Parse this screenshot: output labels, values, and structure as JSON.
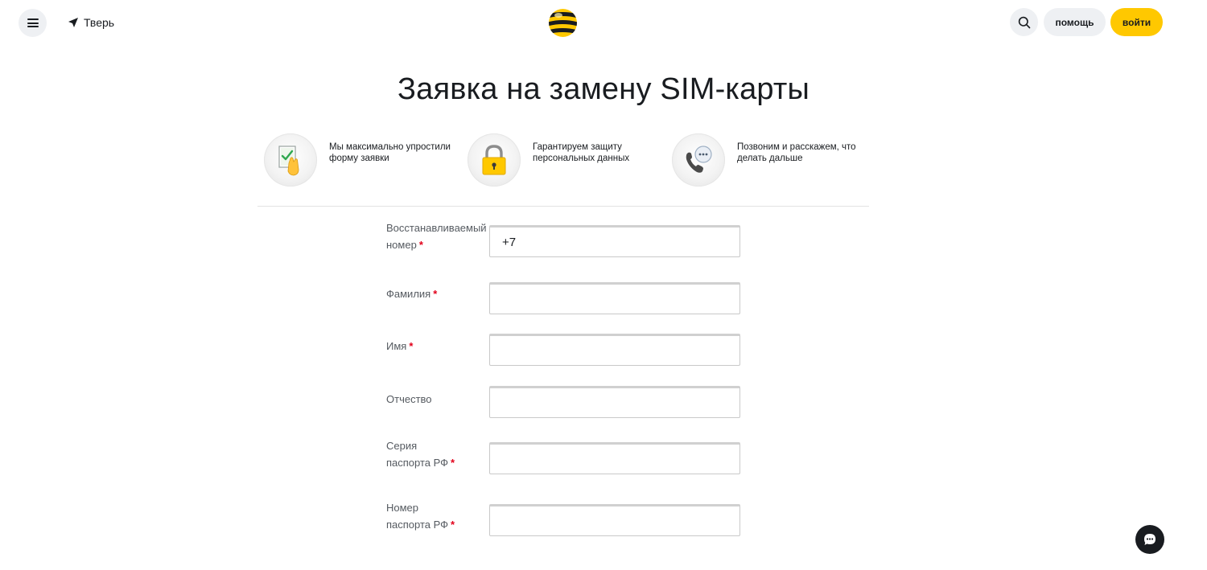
{
  "header": {
    "city": "Тверь",
    "help_label": "помощь",
    "login_label": "войти"
  },
  "title": "Заявка на замену SIM-карты",
  "features": [
    {
      "icon": "document-hand-check-icon",
      "text_line1": "Мы максимально упростили",
      "text_line2": "форму заявки"
    },
    {
      "icon": "padlock-icon",
      "text_line1": "Гарантируем защиту",
      "text_line2": "персональных данных"
    },
    {
      "icon": "phone-chat-icon",
      "text_line1": "Позвоним и расскажем, что",
      "text_line2": "делать дальше"
    }
  ],
  "form": {
    "fields": [
      {
        "label_line1": "Восстанавливаемый",
        "label_line2": "номер",
        "required_mark": "*",
        "value": "+7"
      },
      {
        "label_line1": "Фамилия",
        "required_mark": "*",
        "value": ""
      },
      {
        "label_line1": "Имя",
        "required_mark": "*",
        "value": ""
      },
      {
        "label_line1": "Отчество",
        "value": ""
      },
      {
        "label_line1": "Серия",
        "label_line2": "паспорта РФ",
        "required_mark": "*",
        "value": ""
      },
      {
        "label_line1": "Номер",
        "label_line2": "паспорта РФ",
        "required_mark": "*",
        "value": ""
      }
    ]
  },
  "colors": {
    "accent": "#ffc800",
    "required": "#e2001a",
    "pill_bg": "#eef0f3",
    "text": "#191c20"
  }
}
